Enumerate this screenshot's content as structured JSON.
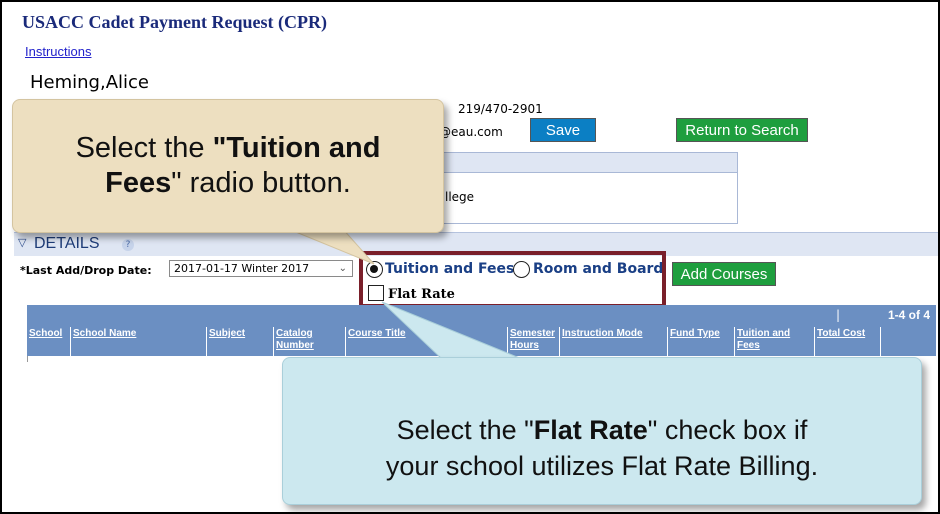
{
  "header": {
    "title": "USACC Cadet Payment Request (CPR)",
    "instructions_link": "Instructions"
  },
  "student": {
    "name": "Heming,Alice",
    "phone": "219/470-2901",
    "email_fragment": "@eau.com",
    "school_fragment": "llege"
  },
  "buttons": {
    "save": "Save",
    "return_to_search": "Return to Search",
    "add_courses": "Add Courses"
  },
  "details": {
    "toggle_icon": "▽",
    "section_label": "DETAILS",
    "help_icon": "?",
    "date_label": "*Last Add/Drop Date:",
    "date_value": "2017-01-17 Winter 2017",
    "date_chevron": "⌄",
    "radio_tuition": "Tuition and Fees",
    "radio_room": "Room and Board",
    "checkbox_flat_rate": "Flat Rate"
  },
  "grid": {
    "pager_separator": "|",
    "pager": "1-4 of 4",
    "columns": [
      "School",
      "School Name",
      "Subject",
      "Catalog Number",
      "Course Title",
      "Semester Hours",
      "Instruction Mode",
      "Fund Type",
      "Tuition and Fees",
      "Total Cost",
      ""
    ]
  },
  "callouts": {
    "top": {
      "line1_prefix": "Select the ",
      "line1_bold": "\"Tuition and",
      "line2_bold": "Fees",
      "line2_suffix": "\" radio button."
    },
    "bottom": {
      "line1_prefix": "Select the \"",
      "line1_bold": "Flat Rate",
      "line1_suffix": "\" check box if",
      "line2": "your school utilizes Flat Rate Billing."
    }
  },
  "colors": {
    "title": "#1a2a7a",
    "save_button": "#0b7fc4",
    "green_button": "#1e9e3e",
    "grid_header": "#6b8fc2",
    "highlight_border": "#7a1f2a",
    "callout_top": "#eddfc0",
    "callout_bottom": "#cce8ef"
  }
}
